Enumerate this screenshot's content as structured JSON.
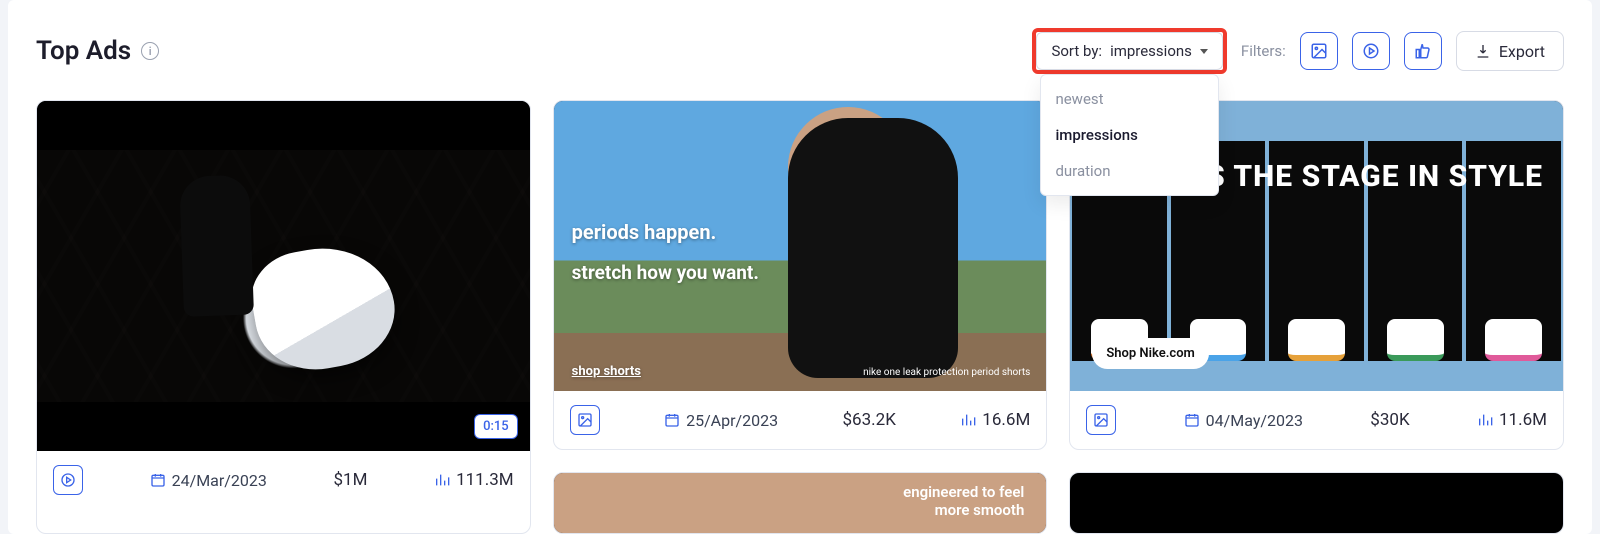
{
  "header": {
    "title": "Top Ads",
    "sort_label_prefix": "Sort by: ",
    "sort_selected": "impressions",
    "sort_options": [
      "newest",
      "impressions",
      "duration"
    ],
    "filters_label": "Filters:",
    "export_label": "Export"
  },
  "ads": [
    {
      "type": "video",
      "duration": "0:15",
      "date": "24/Mar/2023",
      "spend": "$1M",
      "impressions": "111.3M"
    },
    {
      "type": "image",
      "overlay": {
        "line1": "periods happen.",
        "line2": "stretch how you want.",
        "cta": "shop shorts",
        "brand": "nike one leak protection period shorts"
      },
      "date": "25/Apr/2023",
      "spend": "$63.2K",
      "impressions": "16.6M"
    },
    {
      "type": "image",
      "overlay": {
        "headline": "S THE STAGE IN STYLE",
        "cta": "Shop Nike.com"
      },
      "date": "04/May/2023",
      "spend": "$30K",
      "impressions": "11.6M"
    },
    {
      "type": "image",
      "overlay": {
        "line1": "engineered to feel",
        "line2": "more smooth"
      }
    },
    {
      "type": "video"
    }
  ]
}
